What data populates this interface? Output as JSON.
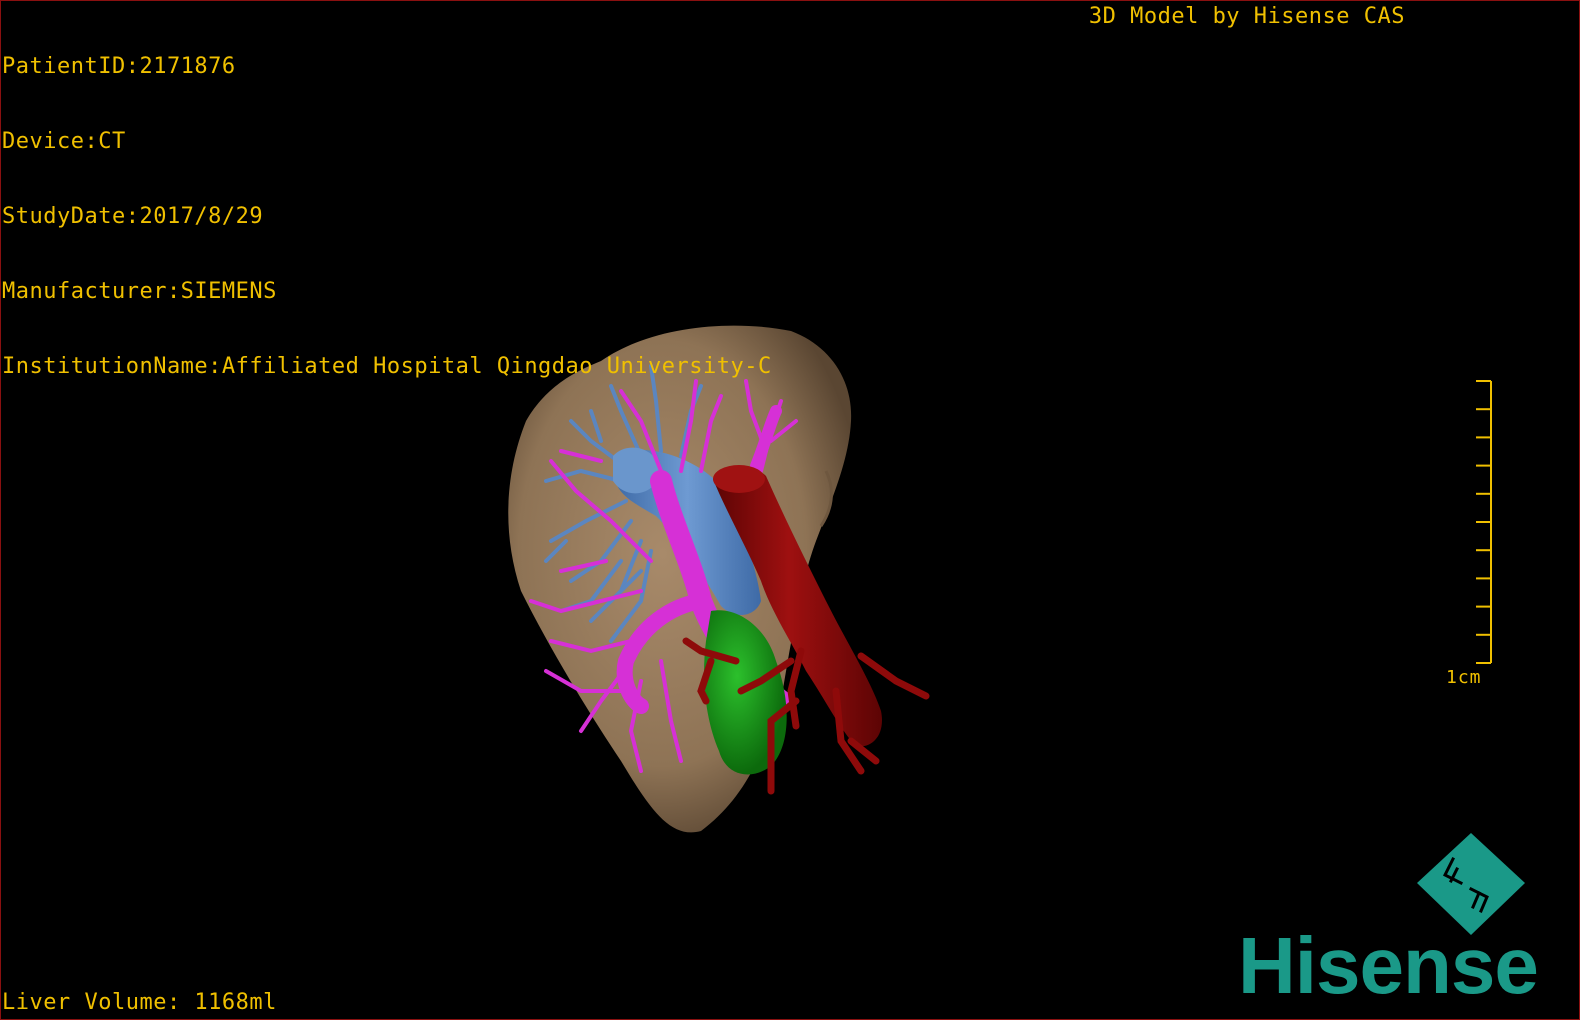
{
  "header": {
    "patient_id": "PatientID:2171876",
    "device": "Device:CT",
    "study_date": "StudyDate:2017/8/29",
    "manufacturer": "Manufacturer:SIEMENS",
    "institution": "InstitutionName:Affiliated Hospital Qingdao University-C",
    "brand_title": "3D Model by Hisense CAS"
  },
  "footer": {
    "liver_volume": "Liver Volume: 1168ml"
  },
  "scale": {
    "label": "1cm",
    "tick_count": 10
  },
  "logo": {
    "text": "Hisense",
    "color": "#1a9988"
  },
  "model_colors": {
    "liver": "#9c8063",
    "portal_vein": "#d630d6",
    "hepatic_vein": "#5b86c0",
    "artery": "#8e0a0a",
    "gallbladder": "#1a9a1a"
  },
  "overlay_text_color": "#f0c000"
}
